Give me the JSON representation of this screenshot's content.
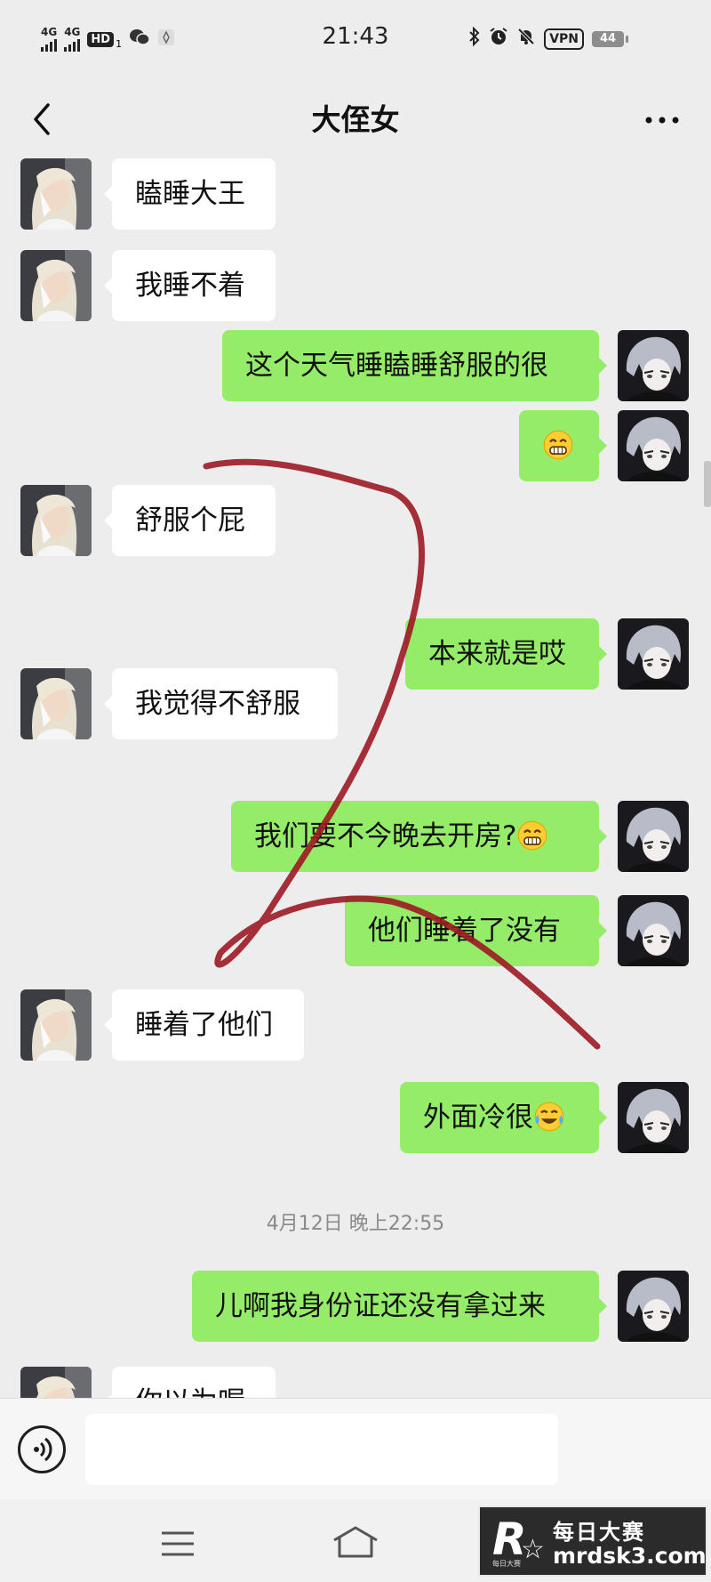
{
  "status_bar": {
    "sim1": "4G",
    "sim2": "4G",
    "hd": "HD",
    "hd_sub": "1",
    "time": "21:43",
    "vpn": "VPN",
    "battery": "44"
  },
  "header": {
    "title": "大侄女"
  },
  "messages": [
    {
      "side": "in",
      "text": "瞌睡大王"
    },
    {
      "side": "in",
      "text": "我睡不着"
    },
    {
      "side": "out",
      "text": "这个天气睡瞌睡舒服的很"
    },
    {
      "side": "out",
      "text": "",
      "emoji": "grin"
    },
    {
      "side": "in",
      "text": "舒服个屁"
    },
    {
      "side": "out",
      "text": "本来就是哎"
    },
    {
      "side": "in",
      "text": "我觉得不舒服"
    },
    {
      "side": "out",
      "text": "我们要不今晚去开房?",
      "emoji": "grin"
    },
    {
      "side": "out",
      "text": "他们睡着了没有"
    },
    {
      "side": "in",
      "text": "睡着了他们"
    },
    {
      "side": "out",
      "text": "外面冷很",
      "emoji": "cry-laugh"
    },
    {
      "side": "out",
      "text": "儿啊我身份证还没有拿过来"
    },
    {
      "side": "in",
      "text": "你以为喔"
    }
  ],
  "time_divider": "4月12日 晚上22:55",
  "input": {
    "placeholder": ""
  },
  "watermark": {
    "logo": "R",
    "logo_sub": "每日大赛",
    "title": "每日大赛",
    "url": "mrdsk3.com"
  },
  "colors": {
    "background": "#ededed",
    "outgoing_bubble": "#95ec69",
    "incoming_bubble": "#ffffff",
    "scribble": "#9c1a24"
  },
  "icons": {
    "back": "chevron-left-icon",
    "more": "more-dots-icon",
    "voice": "voice-icon",
    "menu": "menu-icon",
    "home": "home-icon",
    "bluetooth": "bluetooth-icon",
    "alarm": "alarm-icon",
    "mute": "bell-off-icon",
    "wechat": "wechat-icon",
    "location": "location-icon"
  }
}
